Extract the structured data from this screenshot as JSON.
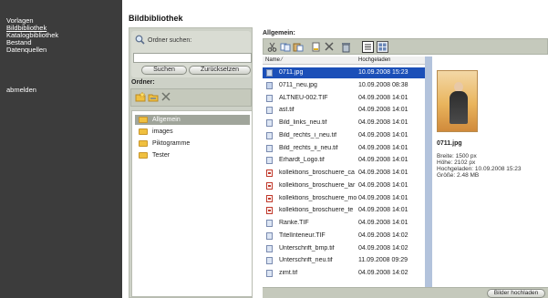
{
  "sidebar": {
    "items": [
      {
        "label": "Vorlagen"
      },
      {
        "label": "Bildbibliothek",
        "selected": true
      },
      {
        "label": "Katalogbibliothek"
      },
      {
        "label": "Bestand"
      },
      {
        "label": "Datenquellen"
      }
    ],
    "logout": "abmelden"
  },
  "page": {
    "title": "Bildbibliothek"
  },
  "search": {
    "label": "Ordner suchen:",
    "value": "",
    "search_button": "Suchen",
    "reset_button": "Zurücksetzen"
  },
  "folders": {
    "label": "Ordner:",
    "items": [
      {
        "name": "Allgemein",
        "selected": true
      },
      {
        "name": "images"
      },
      {
        "name": "Piktogramme"
      },
      {
        "name": "Tester"
      }
    ]
  },
  "files": {
    "label": "Allgemein:",
    "columns": {
      "name": "Name ⁄",
      "uploaded": "Hochgeladen"
    },
    "rows": [
      {
        "name": "0711.jpg",
        "date": "10.09.2008 15:23",
        "type": "img",
        "selected": true
      },
      {
        "name": "0711_neu.jpg",
        "date": "10.09.2008 08:38",
        "type": "img"
      },
      {
        "name": "ALTNEU-002.TIF",
        "date": "04.09.2008 14:01",
        "type": "tif"
      },
      {
        "name": "ast.tif",
        "date": "04.09.2008 14:01",
        "type": "tif"
      },
      {
        "name": "Bild_links_neu.tif",
        "date": "04.09.2008 14:01",
        "type": "tif"
      },
      {
        "name": "Bild_rechts_i_neu.tif",
        "date": "04.09.2008 14:01",
        "type": "tif"
      },
      {
        "name": "Bild_rechts_ii_neu.tif",
        "date": "04.09.2008 14:01",
        "type": "tif"
      },
      {
        "name": "Erhardt_Logo.tif",
        "date": "04.09.2008 14:01",
        "type": "tif"
      },
      {
        "name": "kollektions_broschuere_ca",
        "date": "04.09.2008 14:01",
        "type": "pdf"
      },
      {
        "name": "kollektions_broschuere_lar",
        "date": "04.09.2008 14:01",
        "type": "pdf"
      },
      {
        "name": "kollektions_broschuere_mo",
        "date": "04.09.2008 14:01",
        "type": "pdf"
      },
      {
        "name": "kollektions_broschuere_te",
        "date": "04.09.2008 14:01",
        "type": "pdf"
      },
      {
        "name": "Ranke.TIF",
        "date": "04.09.2008 14:01",
        "type": "tif"
      },
      {
        "name": "TitelInterieur.TIF",
        "date": "04.09.2008 14:02",
        "type": "tif"
      },
      {
        "name": "Unterschrift_bmp.tif",
        "date": "04.09.2008 14:02",
        "type": "tif"
      },
      {
        "name": "Unterschrift_neu.tif",
        "date": "11.09.2008 09:29",
        "type": "tif"
      },
      {
        "name": "zimt.tif",
        "date": "04.09.2008 14:02",
        "type": "tif"
      }
    ]
  },
  "detail": {
    "name": "0711.jpg",
    "width": "Breite: 1500 px",
    "height": "Höhe: 2102 px",
    "uploaded": "Hochgeladen: 10.09.2008 15:23",
    "size": "Größe: 2.48 MB"
  },
  "upload_button": "Bilder hochladen",
  "colors": {
    "sidebar": "#3c3c3c",
    "panel": "#cdd1c7",
    "selection": "#1b4fb8"
  },
  "icons": [
    "search-icon",
    "new-folder-icon",
    "rename-folder-icon",
    "delete-icon",
    "cut-icon",
    "copy-icon",
    "paste-icon",
    "document-icon",
    "trash-icon",
    "list-view-icon",
    "thumbnail-view-icon",
    "folder-icon"
  ]
}
